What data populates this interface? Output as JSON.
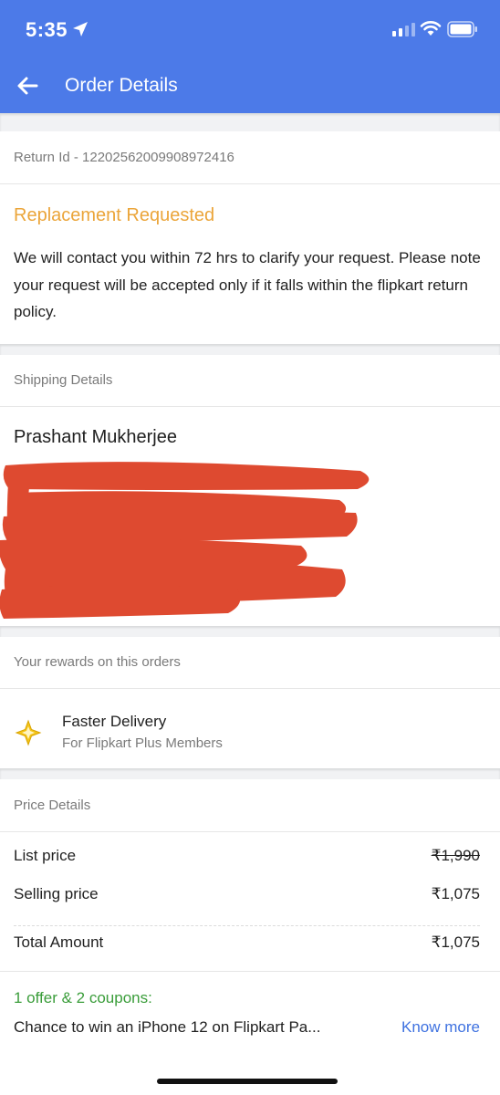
{
  "status_bar": {
    "time": "5:35",
    "icons": [
      "location-arrow-icon",
      "cellular-signal-icon",
      "wifi-icon",
      "battery-icon"
    ]
  },
  "app_bar": {
    "title": "Order Details",
    "back_icon": "back-arrow-icon",
    "color": "#4c7ae8"
  },
  "return_info": {
    "return_id": "Return Id - 12202562009908972416"
  },
  "request_status": {
    "title": "Replacement Requested",
    "title_color": "#eba53a",
    "message": "We will contact you within 72 hrs to clarify your request. Please note your request will be accepted only if it falls within the flipkart return policy."
  },
  "shipping": {
    "header": "Shipping Details",
    "name": "Prashant Mukherjee",
    "address_redacted": true
  },
  "rewards": {
    "header": "Your rewards on this orders",
    "items": [
      {
        "icon": "flipkart-plus-icon",
        "title": "Faster Delivery",
        "subtitle": "For Flipkart Plus Members"
      }
    ]
  },
  "price_details": {
    "header": "Price Details",
    "rows": [
      {
        "label": "List price",
        "value": "₹1,990",
        "struck": true
      },
      {
        "label": "Selling price",
        "value": "₹1,075",
        "struck": false
      }
    ],
    "total": {
      "label": "Total Amount",
      "value": "₹1,075"
    }
  },
  "offers": {
    "title": "1 offer & 2 coupons:",
    "title_color": "#3a9d3a",
    "text": "Chance to win an iPhone 12 on Flipkart Pa...",
    "link_label": "Know more",
    "link_color": "#3f72e0"
  }
}
